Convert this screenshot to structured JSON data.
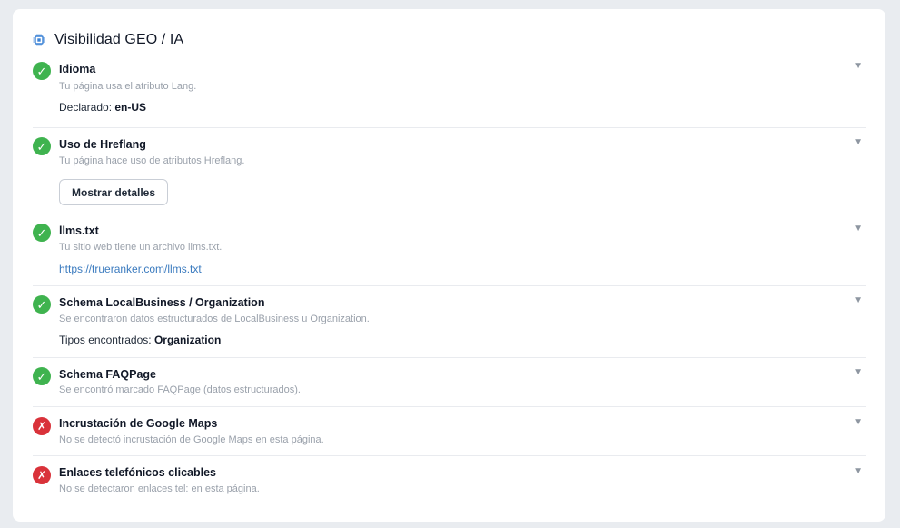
{
  "section": {
    "title": "Visibilidad GEO / IA",
    "icon": "chip-icon"
  },
  "colors": {
    "pass": "#3fb34f",
    "fail": "#d9323a",
    "link": "#3b7bbf"
  },
  "checks": [
    {
      "status": "pass",
      "status_glyph": "✓",
      "title": "Idioma",
      "description": "Tu página usa el atributo Lang.",
      "extra_label": "Declarado:",
      "extra_value": "en-US"
    },
    {
      "status": "pass",
      "status_glyph": "✓",
      "title": "Uso de Hreflang",
      "description": "Tu página hace uso de atributos Hreflang.",
      "button_label": "Mostrar detalles"
    },
    {
      "status": "pass",
      "status_glyph": "✓",
      "title": "llms.txt",
      "description": "Tu sitio web tiene un archivo llms.txt.",
      "link_text": "https://trueranker.com/llms.txt"
    },
    {
      "status": "pass",
      "status_glyph": "✓",
      "title": "Schema LocalBusiness / Organization",
      "description": "Se encontraron datos estructurados de LocalBusiness u Organization.",
      "extra_label": "Tipos encontrados:",
      "extra_value": "Organization"
    },
    {
      "status": "pass",
      "status_glyph": "✓",
      "title": "Schema FAQPage",
      "description": "Se encontró marcado FAQPage (datos estructurados)."
    },
    {
      "status": "fail",
      "status_glyph": "✗",
      "title": "Incrustación de Google Maps",
      "description": "No se detectó incrustación de Google Maps en esta página."
    },
    {
      "status": "fail",
      "status_glyph": "✗",
      "title": "Enlaces telefónicos clicables",
      "description": "No se detectaron enlaces tel: en esta página."
    }
  ],
  "caret_glyph": "▼"
}
